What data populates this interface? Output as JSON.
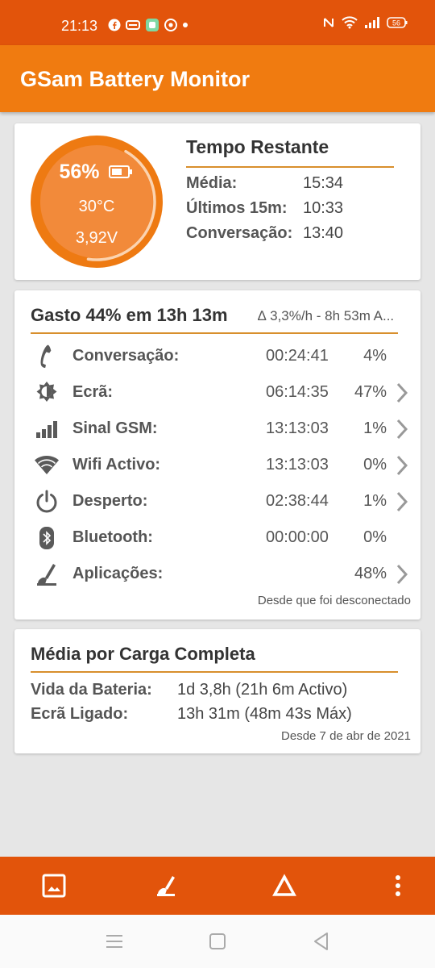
{
  "status_bar": {
    "time": "21:13",
    "battery_level": "56"
  },
  "app": {
    "title": "GSam Battery Monitor"
  },
  "gauge": {
    "percent_text": "56%",
    "level_fraction": 0.56,
    "temperature": "30°C",
    "voltage": "3,92V"
  },
  "time_remaining": {
    "title": "Tempo Restante",
    "rows": [
      {
        "label": "Média:",
        "value": "15:34"
      },
      {
        "label": "Últimos 15m:",
        "value": "10:33"
      },
      {
        "label": "Conversação:",
        "value": "13:40"
      }
    ]
  },
  "usage": {
    "title": "Gasto 44% em 13h 13m",
    "subtitle": "∆ 3,3%/h - 8h 53m A...",
    "footer": "Desde que foi desconectado",
    "rows": [
      {
        "icon": "phone-icon",
        "label": "Conversação:",
        "time": "00:24:41",
        "percent": "4%",
        "chevron": false
      },
      {
        "icon": "screen-brightness-icon",
        "label": "Ecrã:",
        "time": "06:14:35",
        "percent": "47%",
        "chevron": true
      },
      {
        "icon": "signal-bars-icon",
        "label": "Sinal GSM:",
        "time": "13:13:03",
        "percent": "1%",
        "chevron": true
      },
      {
        "icon": "wifi-icon",
        "label": "Wifi Activo:",
        "time": "13:13:03",
        "percent": "0%",
        "chevron": true
      },
      {
        "icon": "power-icon",
        "label": "Desperto:",
        "time": "02:38:44",
        "percent": "1%",
        "chevron": true
      },
      {
        "icon": "bluetooth-icon",
        "label": "Bluetooth:",
        "time": "00:00:00",
        "percent": "0%",
        "chevron": false
      },
      {
        "icon": "apps-icon",
        "label": "Aplicações:",
        "time": "",
        "percent": "48%",
        "chevron": true
      }
    ]
  },
  "full_charge": {
    "title": "Média por Carga Completa",
    "rows": [
      {
        "label": "Vida da Bateria:",
        "value": "1d 3,8h (21h 6m Activo)"
      },
      {
        "label": "Ecrã Ligado:",
        "value": "13h 31m (48m 43s Máx)"
      }
    ],
    "footer": "Desde 7 de abr de 2021"
  },
  "colors": {
    "status_bar": "#e2540b",
    "app_bar": "#f07b10",
    "gauge_fill": "#f28a3a",
    "gauge_ring": "#ee7a12",
    "accent_line": "#d88f2d"
  }
}
